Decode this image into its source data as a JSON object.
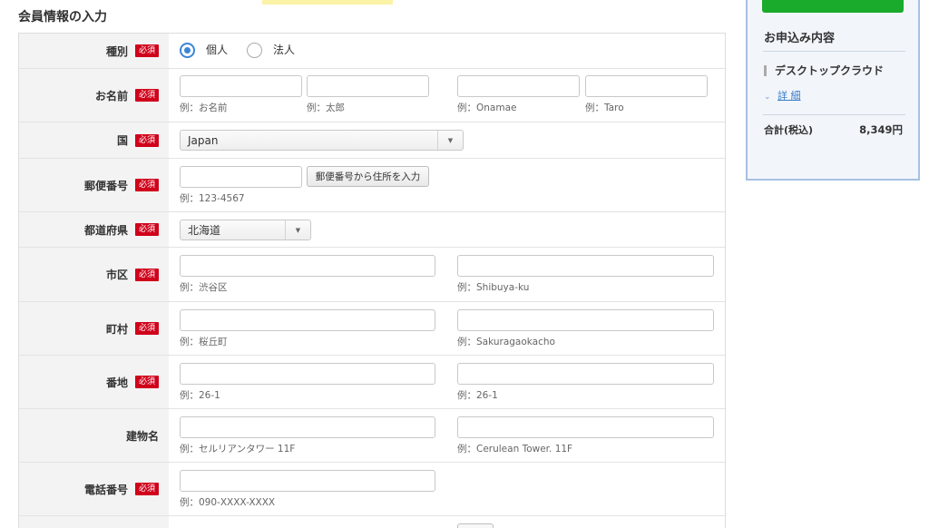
{
  "section_title": "会員情報の入力",
  "required_label": "必須",
  "rows": {
    "type": {
      "label": "種別",
      "options": [
        {
          "label": "個人",
          "checked": true
        },
        {
          "label": "法人",
          "checked": false
        }
      ]
    },
    "name": {
      "label": "お名前",
      "fields": [
        {
          "value": "",
          "hint": "例：お名前"
        },
        {
          "value": "",
          "hint": "例：太郎"
        },
        {
          "value": "",
          "hint": "例：Onamae"
        },
        {
          "value": "",
          "hint": "例：Taro"
        }
      ]
    },
    "country": {
      "label": "国",
      "selected": "Japan"
    },
    "postal": {
      "label": "郵便番号",
      "value": "",
      "hint": "例：123-4567",
      "button": "郵便番号から住所を入力"
    },
    "prefecture": {
      "label": "都道府県",
      "selected": "北海道"
    },
    "city": {
      "label": "市区",
      "fields": [
        {
          "value": "",
          "hint": "例：渋谷区"
        },
        {
          "value": "",
          "hint": "例：Shibuya-ku"
        }
      ]
    },
    "town": {
      "label": "町村",
      "fields": [
        {
          "value": "",
          "hint": "例：桜丘町"
        },
        {
          "value": "",
          "hint": "例：Sakuragaokacho"
        }
      ]
    },
    "address": {
      "label": "番地",
      "fields": [
        {
          "value": "",
          "hint": "例：26-1"
        },
        {
          "value": "",
          "hint": "例：26-1"
        }
      ]
    },
    "building": {
      "label": "建物名",
      "fields": [
        {
          "value": "",
          "hint": "例：セルリアンタワー 11F"
        },
        {
          "value": "",
          "hint": "例：Cerulean Tower. 11F"
        }
      ]
    },
    "phone": {
      "label": "電話番号",
      "value": "",
      "hint": "例：090-XXXX-XXXX"
    }
  },
  "side_panel": {
    "title": "お申込み内容",
    "product": "デスクトップクラウド",
    "detail_link": "詳 細",
    "total_label": "合計(税込)",
    "total_value": "8,349円"
  },
  "colors": {
    "required": "#d0021b",
    "accent": "#3b86d6",
    "panel_border": "#a8c0e2",
    "green_button": "#1aaa2c"
  }
}
